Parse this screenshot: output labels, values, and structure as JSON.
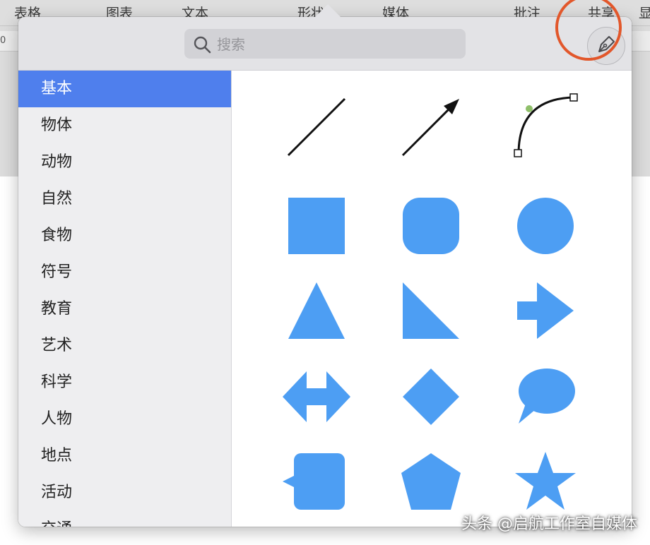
{
  "background": {
    "tabs": [
      "表格",
      "图表",
      "文本",
      "形状",
      "媒体",
      "批注",
      "共享",
      "显"
    ],
    "ruler_zero": "0"
  },
  "search": {
    "placeholder": "搜索",
    "value": ""
  },
  "pen_tool": {
    "icon": "pen-nib-icon"
  },
  "sidebar": {
    "active_index": 0,
    "items": [
      "基本",
      "物体",
      "动物",
      "自然",
      "食物",
      "符号",
      "教育",
      "艺术",
      "科学",
      "人物",
      "地点",
      "活动",
      "交通"
    ]
  },
  "shapes": {
    "fill_color": "#4d9ef3",
    "items": [
      "line",
      "arrow-line",
      "curve",
      "square",
      "rounded-square",
      "circle",
      "triangle",
      "right-triangle",
      "arrow-right",
      "double-arrow",
      "diamond",
      "speech-bubble",
      "callout-square",
      "pentagon",
      "star"
    ]
  },
  "colors": {
    "accent": "#4f7fed",
    "highlight_ring": "#e2572b"
  },
  "watermark": "头条 @启航工作室自媒体"
}
